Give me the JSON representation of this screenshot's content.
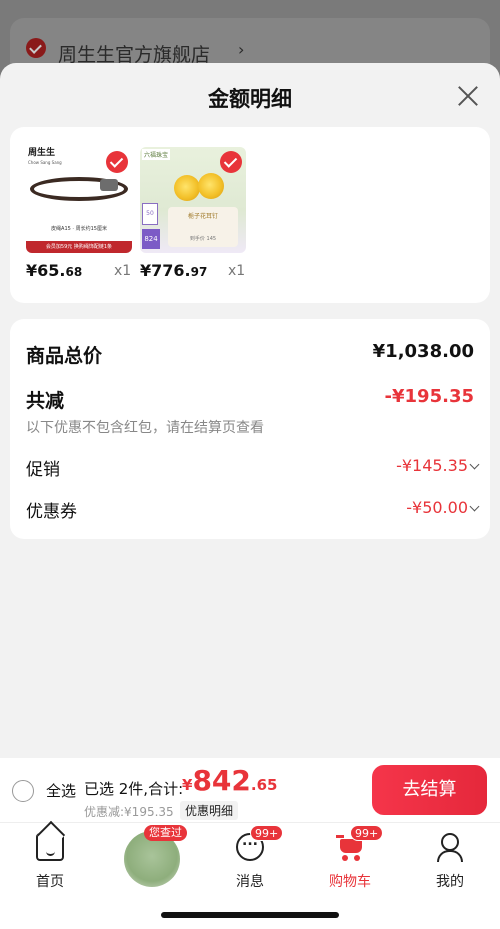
{
  "background": {
    "store_name": "周生生官方旗舰店",
    "store_chevron": "›"
  },
  "sheet": {
    "title": "金额明细"
  },
  "products": [
    {
      "brand": "周生生",
      "brand_sub": "Chow Sang Sang",
      "caption": "皮绳A15 · 周长约15厘米",
      "promo_strip": "会员加59元 换购绳饰配链1条",
      "price_int": "¥65.",
      "price_dec": "68",
      "qty": "x1"
    },
    {
      "brand": "六福珠宝",
      "panel_title": "栀子花耳钉",
      "panel_sub": "到手价 145",
      "badge1": "50",
      "badge2": "824",
      "price_int": "¥776.",
      "price_dec": "97",
      "qty": "x1"
    }
  ],
  "summary": {
    "total_label": "商品总价",
    "total_value": "¥1,038.00",
    "reduce_label": "共减",
    "reduce_value": "-¥195.35",
    "reduce_note": "以下优惠不包含红包，请在结算页查看",
    "promo_label": "促销",
    "promo_value": "-¥145.35",
    "coupon_label": "优惠券",
    "coupon_value": "-¥50.00"
  },
  "checkout": {
    "select_all": "全选",
    "selected_text": "已选 2件,合计:",
    "currency": "¥",
    "total_int": "842",
    "total_dec": ".65",
    "discount_line": "优惠减:¥195.35",
    "detail_link": "优惠明细",
    "checkout_button": "去结算"
  },
  "tabs": {
    "home": "首页",
    "viewed_tag": "您查过",
    "messages": "消息",
    "messages_badge": "99+",
    "cart": "购物车",
    "cart_badge": "99+",
    "me": "我的"
  },
  "colors": {
    "accent": "#e8343a",
    "sheet_bg": "#f2f2f2"
  }
}
